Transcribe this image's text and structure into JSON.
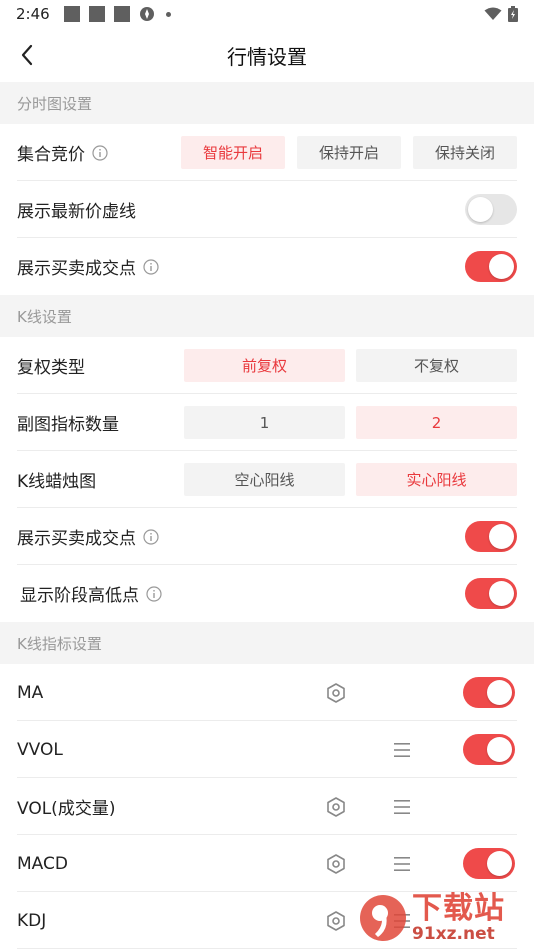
{
  "status": {
    "time": "2:46"
  },
  "nav": {
    "title": "行情设置"
  },
  "sections": {
    "fenshi": "分时图设置",
    "kline": "K线设置",
    "indicator": "K线指标设置"
  },
  "fenshi": {
    "auction": {
      "label": "集合竞价",
      "options": [
        "智能开启",
        "保持开启",
        "保持关闭"
      ],
      "selected": 0
    },
    "latest_price_line": {
      "label": "展示最新价虚线",
      "on": false
    },
    "trade_points": {
      "label": "展示买卖成交点",
      "on": true
    }
  },
  "kline": {
    "adjust": {
      "label": "复权类型",
      "options": [
        "前复权",
        "不复权"
      ],
      "selected": 0
    },
    "sub_chart_count": {
      "label": "副图指标数量",
      "options": [
        "1",
        "2"
      ],
      "selected": 1
    },
    "candle": {
      "label": "K线蜡烛图",
      "options": [
        "空心阳线",
        "实心阳线"
      ],
      "selected": 1
    },
    "trade_points": {
      "label": "展示买卖成交点",
      "on": true
    },
    "stage_high_low": {
      "label": "显示阶段高低点",
      "on": true
    }
  },
  "indicators": [
    {
      "name": "MA",
      "gear": true,
      "menu": false,
      "on": true
    },
    {
      "name": "VVOL",
      "gear": false,
      "menu": true,
      "on": true
    },
    {
      "name": "VOL(成交量)",
      "gear": true,
      "menu": true,
      "on": null
    },
    {
      "name": "MACD",
      "gear": true,
      "menu": true,
      "on": true
    },
    {
      "name": "KDJ",
      "gear": true,
      "menu": true,
      "on": null
    }
  ],
  "watermark": {
    "brand": "下载站",
    "domain": "91xz.net"
  },
  "colors": {
    "accent": "#ef4a4a",
    "selected_bg": "#fdecec",
    "selected_text": "#e9393d",
    "section_bg": "#f4f4f4"
  }
}
